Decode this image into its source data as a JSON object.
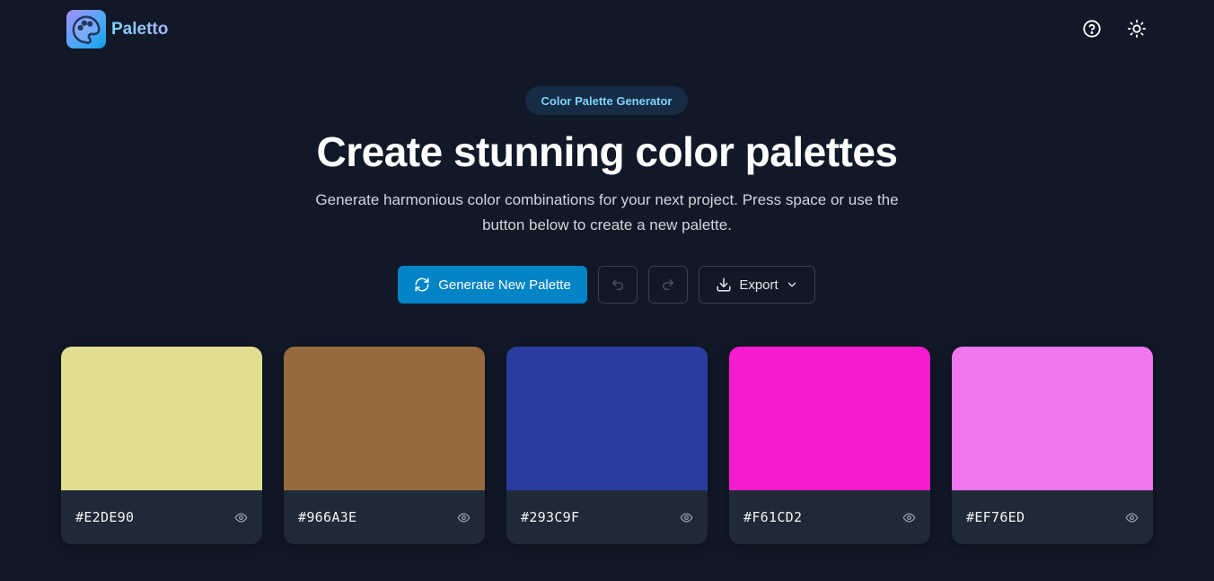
{
  "header": {
    "brand": "Paletto",
    "icons": {
      "logo": "palette-icon",
      "help": "help-circle-icon",
      "theme": "sun-icon"
    }
  },
  "hero": {
    "badge": "Color Palette Generator",
    "title": "Create stunning color palettes",
    "subtitle": "Generate harmonious color combinations for your next project. Press space or use the button below to create a new palette."
  },
  "actions": {
    "generate_label": "Generate New Palette",
    "export_label": "Export",
    "icons": {
      "generate": "refresh-icon",
      "undo": "undo-icon",
      "redo": "redo-icon",
      "export": "download-icon",
      "chevron": "chevron-down-icon"
    }
  },
  "palette": [
    {
      "hex": "#E2DE90",
      "color": "#E2DE90"
    },
    {
      "hex": "#966A3E",
      "color": "#966A3E"
    },
    {
      "hex": "#293C9F",
      "color": "#293C9F"
    },
    {
      "hex": "#F61CD2",
      "color": "#F61CD2"
    },
    {
      "hex": "#EF76ED",
      "color": "#EF76ED"
    }
  ],
  "colors": {
    "background": "#111827",
    "primary": "#0284c7",
    "card": "#1f2937",
    "badge_text": "#7dd3fc"
  }
}
